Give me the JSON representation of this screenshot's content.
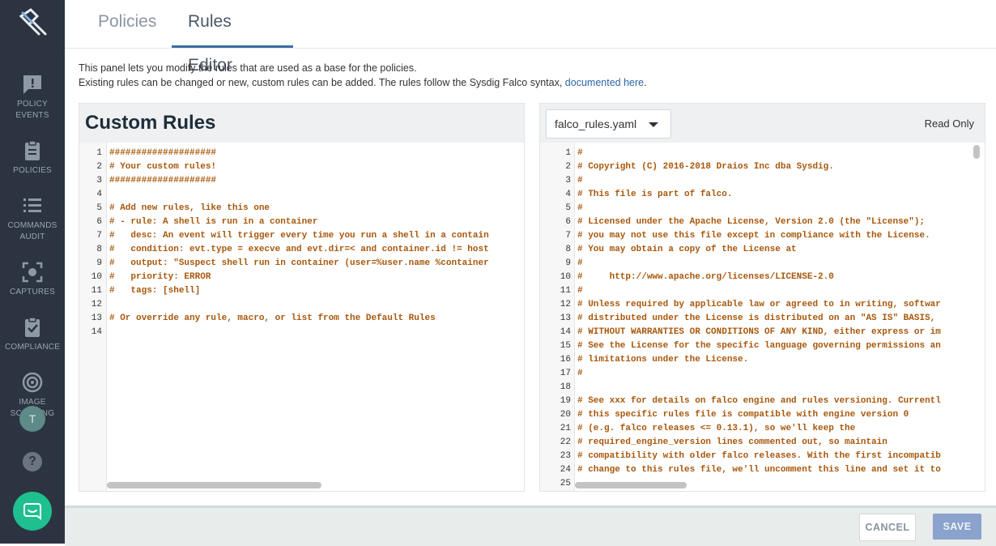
{
  "sidebar": {
    "items": [
      {
        "label_line1": "POLICY",
        "label_line2": "EVENTS",
        "icon": "alert-icon"
      },
      {
        "label_line1": "POLICIES",
        "label_line2": "",
        "icon": "clipboard-icon"
      },
      {
        "label_line1": "COMMANDS",
        "label_line2": "AUDIT",
        "icon": "list-icon"
      },
      {
        "label_line1": "CAPTURES",
        "label_line2": "",
        "icon": "capture-icon"
      },
      {
        "label_line1": "COMPLIANCE",
        "label_line2": "",
        "icon": "clipboard-check-icon"
      },
      {
        "label_line1": "IMAGE",
        "label_line2": "SCANNING",
        "icon": "target-icon"
      }
    ],
    "avatar_initial": "T",
    "help": "?"
  },
  "tabs": [
    {
      "label": "Policies",
      "active": false
    },
    {
      "label": "Rules Editor",
      "active": true
    }
  ],
  "description": {
    "line1": "This panel lets you modify the rules that are used as a base for the policies.",
    "line2": "Existing rules can be changed or new, custom rules can be added. The rules follow the Sysdig Falco syntax, ",
    "link": "documented here",
    "line2_end": "."
  },
  "custom_rules": {
    "title": "Custom Rules",
    "lines": [
      "####################",
      "# Your custom rules!",
      "####################",
      "",
      "# Add new rules, like this one",
      "# - rule: A shell is run in a container",
      "#   desc: An event will trigger every time you run a shell in a contain",
      "#   condition: evt.type = execve and evt.dir=< and container.id != host",
      "#   output: \"Suspect shell run in container (user=%user.name %container",
      "#   priority: ERROR",
      "#   tags: [shell]",
      "",
      "# Or override any rule, macro, or list from the Default Rules",
      ""
    ]
  },
  "default_rules": {
    "file_selected": "falco_rules.yaml",
    "readonly_label": "Read Only",
    "lines": [
      "#",
      "# Copyright (C) 2016-2018 Draios Inc dba Sysdig.",
      "#",
      "# This file is part of falco.",
      "#",
      "# Licensed under the Apache License, Version 2.0 (the \"License\");",
      "# you may not use this file except in compliance with the License.",
      "# You may obtain a copy of the License at",
      "#",
      "#     http://www.apache.org/licenses/LICENSE-2.0",
      "#",
      "# Unless required by applicable law or agreed to in writing, softwar",
      "# distributed under the License is distributed on an \"AS IS\" BASIS,",
      "# WITHOUT WARRANTIES OR CONDITIONS OF ANY KIND, either express or im",
      "# See the License for the specific language governing permissions an",
      "# limitations under the License.",
      "#",
      "",
      "# See xxx for details on falco engine and rules versioning. Currentl",
      "# this specific rules file is compatible with engine version 0",
      "# (e.g. falco releases <= 0.13.1), so we'll keep the",
      "# required_engine_version lines commented out, so maintain",
      "# compatibility with older falco releases. With the first incompatib",
      "# change to this rules file, we'll uncomment this line and set it to",
      ""
    ]
  },
  "footer": {
    "cancel_label": "CANCEL",
    "save_label": "SAVE"
  },
  "colors": {
    "sidebar_bg": "#2b3440",
    "accent": "#3a6ea5",
    "code_text": "#a8570b",
    "save_button": "#8aa2cc"
  }
}
